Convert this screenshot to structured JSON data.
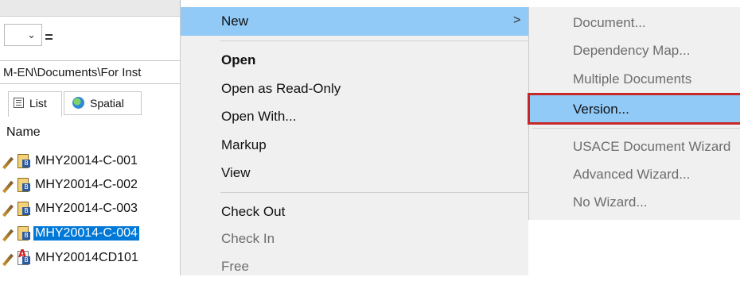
{
  "explorer": {
    "path_text": "M-EN\\Documents\\For Inst",
    "tabs": [
      {
        "label": "List",
        "icon": "list-view-icon"
      },
      {
        "label": "Spatial",
        "icon": "globe-icon"
      }
    ],
    "column_header": "Name",
    "files": [
      {
        "name": "MHY20014-C-001",
        "type": "document",
        "selected": false
      },
      {
        "name": "MHY20014-C-002",
        "type": "document",
        "selected": false
      },
      {
        "name": "MHY20014-C-003",
        "type": "document",
        "selected": false
      },
      {
        "name": "MHY20014-C-004",
        "type": "document",
        "selected": true
      },
      {
        "name": "MHY20014CD101",
        "type": "pdf",
        "selected": false
      }
    ]
  },
  "context_menu": {
    "items": [
      {
        "label": "New",
        "state": "highlighted",
        "has_submenu": true,
        "submenu_arrow": ">"
      },
      {
        "label": "Open",
        "state": "default-bold"
      },
      {
        "label": "Open as Read-Only",
        "state": "enabled"
      },
      {
        "label": "Open With...",
        "state": "enabled"
      },
      {
        "label": "Markup",
        "state": "enabled"
      },
      {
        "label": "View",
        "state": "enabled"
      },
      {
        "label": "Check Out",
        "state": "enabled"
      },
      {
        "label": "Check In",
        "state": "disabled"
      },
      {
        "label": "Free",
        "state": "disabled"
      }
    ]
  },
  "submenu": {
    "items": [
      {
        "label": "Document...",
        "state": "disabled"
      },
      {
        "label": "Dependency Map...",
        "state": "disabled"
      },
      {
        "label": "Multiple Documents",
        "state": "disabled"
      },
      {
        "label": "Version...",
        "state": "highlighted",
        "annotated": true
      },
      {
        "label": "USACE Document Wizard",
        "state": "disabled"
      },
      {
        "label": "Advanced Wizard...",
        "state": "disabled"
      },
      {
        "label": "No Wizard...",
        "state": "disabled"
      }
    ]
  },
  "colors": {
    "highlight": "#91c9f7",
    "selection": "#0078d7",
    "annotation_box": "#c62828",
    "menu_background": "#f0f0f0"
  }
}
